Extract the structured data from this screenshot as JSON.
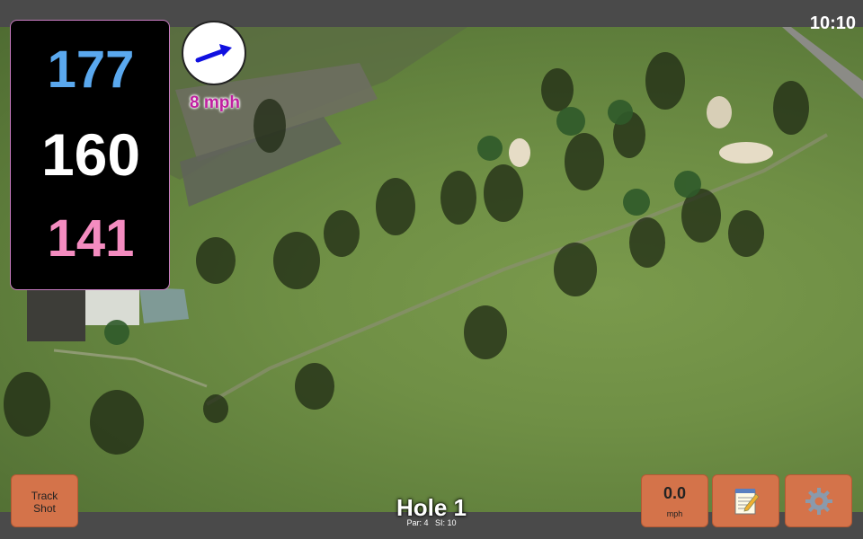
{
  "status": {
    "time": "10:10"
  },
  "yardage": {
    "back": "177",
    "center": "160",
    "front": "141"
  },
  "wind": {
    "speed_label": "8 mph",
    "direction_icon": "wind-arrow-icon"
  },
  "hole": {
    "title": "Hole 1",
    "par_label": "Par: 4",
    "si_label": "SI: 10"
  },
  "buttons": {
    "track_shot_line1": "Track",
    "track_shot_line2": "Shot",
    "speed_value": "0.0",
    "speed_unit": "mph",
    "notes_icon": "notepad-icon",
    "settings_icon": "gear-icon"
  },
  "colors": {
    "back": "#5aa8ee",
    "center": "#ffffff",
    "front": "#f48cc0",
    "wind_text": "#c020a0",
    "button": "#d4734a"
  }
}
